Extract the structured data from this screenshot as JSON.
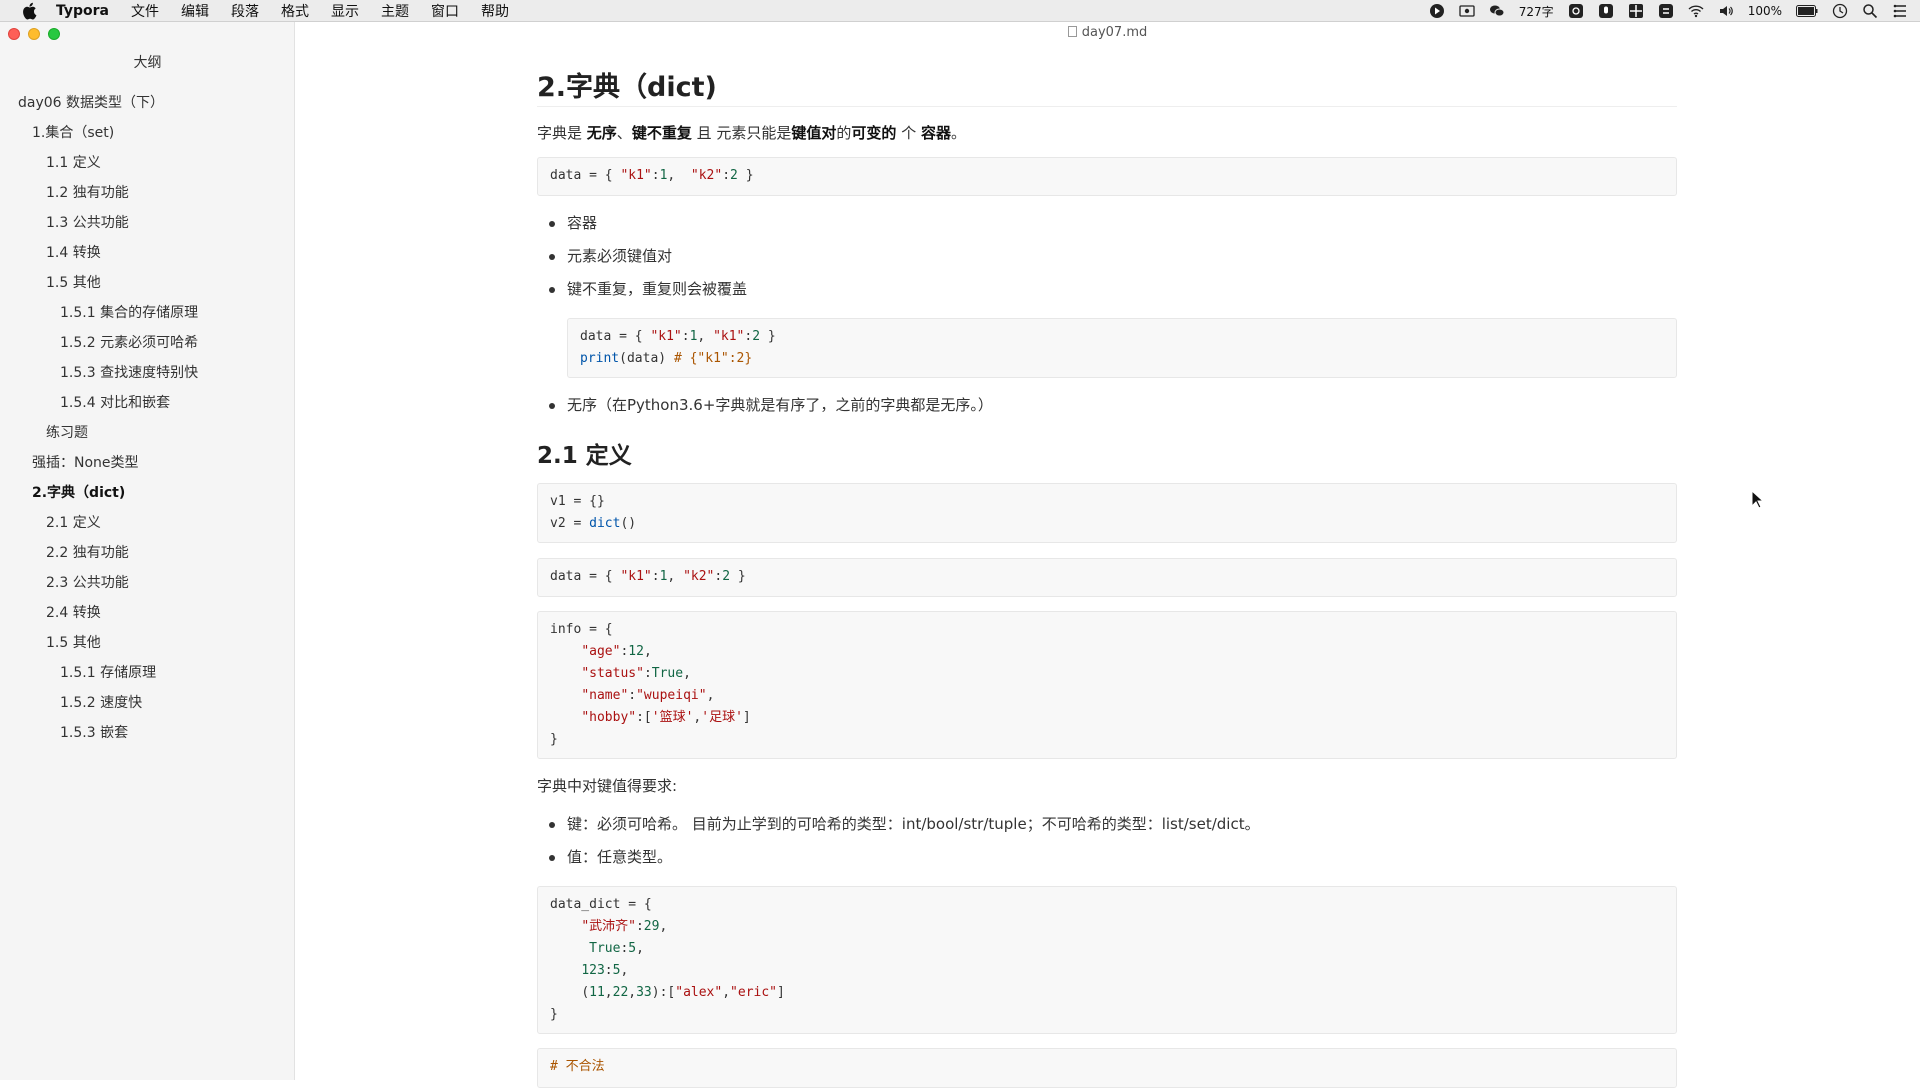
{
  "menubar": {
    "app_name": "Typora",
    "items": [
      "文件",
      "编辑",
      "段落",
      "格式",
      "显示",
      "主题",
      "窗口",
      "帮助"
    ],
    "word_count": "727字",
    "battery": "100%"
  },
  "window": {
    "filename": "day07.md"
  },
  "sidebar": {
    "title": "大纲",
    "items": [
      {
        "label": "day06 数据类型（下）"
      },
      {
        "label": "1.集合（set)"
      },
      {
        "label": "1.1 定义"
      },
      {
        "label": "1.2 独有功能"
      },
      {
        "label": "1.3 公共功能"
      },
      {
        "label": "1.4 转换"
      },
      {
        "label": "1.5 其他"
      },
      {
        "label": "1.5.1 集合的存储原理"
      },
      {
        "label": "1.5.2 元素必须可哈希"
      },
      {
        "label": "1.5.3 查找速度特别快"
      },
      {
        "label": "1.5.4 对比和嵌套"
      },
      {
        "label": "练习题"
      },
      {
        "label": "强插：None类型"
      },
      {
        "label": "2.字典（dict)"
      },
      {
        "label": "2.1 定义"
      },
      {
        "label": "2.2 独有功能"
      },
      {
        "label": "2.3 公共功能"
      },
      {
        "label": "2.4 转换"
      },
      {
        "label": "1.5 其他"
      },
      {
        "label": "1.5.1 存储原理"
      },
      {
        "label": "1.5.2 速度快"
      },
      {
        "label": "1.5.3 嵌套"
      }
    ]
  },
  "doc": {
    "h2": "2.字典（dict)",
    "intro": {
      "p1": "字典是 ",
      "b1": "无序",
      "p2": "、",
      "b2": "键不重复",
      "p3": " 且 元素只能是",
      "b3": "键值对",
      "p4": "的",
      "b4": "可变的",
      "p5": " 个 ",
      "b5": "容器",
      "p6": "。"
    },
    "code1": {
      "a": "data = { ",
      "s1": "\"k1\"",
      "b": ":",
      "n1": "1",
      "c": ",  ",
      "s2": "\"k2\"",
      "d": ":",
      "n2": "2",
      "e": " }"
    },
    "bullets1": [
      "容器",
      "元素必须键值对",
      "键不重复，重复则会被覆盖"
    ],
    "code2": {
      "l1a": "data = { ",
      "l1s1": "\"k1\"",
      "l1b": ":",
      "l1n1": "1",
      "l1c": ", ",
      "l1s2": "\"k1\"",
      "l1d": ":",
      "l1n2": "2",
      "l1e": " }",
      "l2k": "print",
      "l2a": "(data) ",
      "l2c": "# {\"k1\":2}"
    },
    "bullet_after": "无序（在Python3.6+字典就是有序了，之前的字典都是无序。）",
    "h3": "2.1 定义",
    "code3": {
      "l1": "v1 = {}",
      "l2a": "v2 = ",
      "l2k": "dict",
      "l2b": "()"
    },
    "code4": {
      "a": "data = { ",
      "s1": "\"k1\"",
      "b": ":",
      "n1": "1",
      "c": ", ",
      "s2": "\"k2\"",
      "d": ":",
      "n2": "2",
      "e": " }"
    },
    "code5": {
      "l1": "info = {",
      "l2s": "\"age\"",
      "l2a": ":",
      "l2n": "12",
      "l2b": ",",
      "l3s": "\"status\"",
      "l3a": ":",
      "l3k": "True",
      "l3b": ",",
      "l4s": "\"name\"",
      "l4a": ":",
      "l4v": "\"wupeiqi\"",
      "l4b": ",",
      "l5s": "\"hobby\"",
      "l5a": ":[",
      "l5v1": "'篮球'",
      "l5b": ",",
      "l5v2": "'足球'",
      "l5c": "]",
      "l6": "}"
    },
    "para2": "字典中对键值得要求:",
    "bullets2": [
      "键：必须可哈希。 目前为止学到的可哈希的类型：int/bool/str/tuple；不可哈希的类型：list/set/dict。",
      "值：任意类型。"
    ],
    "code6": {
      "l1": "data_dict = {",
      "l2s": "\"武沛齐\"",
      "l2a": ":",
      "l2n": "29",
      "l2b": ",",
      "l3k": "True",
      "l3a": ":",
      "l3n": "5",
      "l3b": ",",
      "l4n": "123",
      "l4a": ":",
      "l4n2": "5",
      "l4b": ",",
      "l5a": "(",
      "l5n1": "11",
      "l5b": ",",
      "l5n2": "22",
      "l5c": ",",
      "l5n3": "33",
      "l5d": "):[",
      "l5s1": "\"alex\"",
      "l5e": ",",
      "l5s2": "\"eric\"",
      "l5f": "]",
      "l6": "}"
    },
    "code7": {
      "c": "# 不合法"
    }
  }
}
